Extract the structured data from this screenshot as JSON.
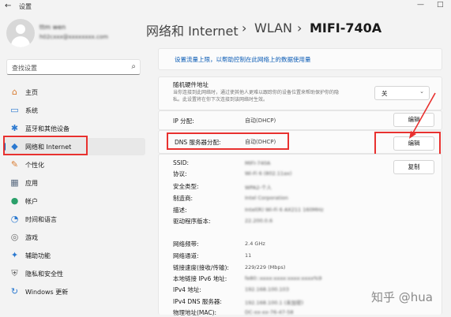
{
  "window": {
    "title": "设置",
    "back_icon": "←",
    "minimize": "—",
    "maximize": "□"
  },
  "user": {
    "name": "ttm wen",
    "email": "h02cxxx@xxxxxxxx.com"
  },
  "search": {
    "placeholder": "查找设置",
    "icon": "⌕"
  },
  "sidebar": {
    "items": [
      {
        "label": "主页",
        "icon": "⌂",
        "color": "#d97b30"
      },
      {
        "label": "系统",
        "icon": "▭",
        "color": "#2b79d0"
      },
      {
        "label": "蓝牙和其他设备",
        "icon": "✱",
        "color": "#2b79d0"
      },
      {
        "label": "网络和 Internet",
        "icon": "◆",
        "color": "#2b79d0"
      },
      {
        "label": "个性化",
        "icon": "✎",
        "color": "#d97b30"
      },
      {
        "label": "应用",
        "icon": "▦",
        "color": "#5a6b80"
      },
      {
        "label": "帐户",
        "icon": "●",
        "color": "#2aa06a"
      },
      {
        "label": "时间和语言",
        "icon": "◔",
        "color": "#2b79d0"
      },
      {
        "label": "游戏",
        "icon": "◎",
        "color": "#6a6a6a"
      },
      {
        "label": "辅助功能",
        "icon": "✦",
        "color": "#2b79d0"
      },
      {
        "label": "隐私和安全性",
        "icon": "⛨",
        "color": "#6a6a6a"
      },
      {
        "label": "Windows 更新",
        "icon": "↻",
        "color": "#2b79d0"
      }
    ]
  },
  "breadcrumb": {
    "part1": "网络和 Internet",
    "sep1": "›",
    "part2": "WLAN",
    "sep2": "›",
    "part3": "MIFI-740A"
  },
  "content": {
    "limit_link": "设置流量上限，以帮助控制在此网络上的数据使用量",
    "random_mac": {
      "title": "随机硬件地址",
      "desc": "当你连接到此网络时，通过使其他人更难以跟踪你的设备位置来帮助保护你的隐\n私。此设置将在你下次连接到该网络时生效。",
      "value": "关"
    },
    "ip_assign": {
      "label": "IP 分配:",
      "value": "自动(DHCP)",
      "button": "编辑"
    },
    "dns_assign": {
      "label": "DNS 服务器分配:",
      "value": "自动(DHCP)",
      "button": "编辑"
    },
    "copy_button": "复制",
    "props": [
      {
        "label": "SSID:",
        "value": "MIFI-740A",
        "blur": true
      },
      {
        "label": "协议:",
        "value": "Wi-Fi 6 (802.11ax)",
        "blur": true
      },
      {
        "label": "安全类型:",
        "value": "WPA2-个人",
        "blur": true
      },
      {
        "label": "制造商:",
        "value": "Intel Corporation",
        "blur": true
      },
      {
        "label": "描述:",
        "value": "Intel(R) Wi-Fi 6 AX211 160MHz",
        "blur": true
      },
      {
        "label": "驱动程序版本:",
        "value": "22.200.0.6",
        "blur": true
      },
      {
        "label": "网络频带:",
        "value": "2.4 GHz",
        "blur": false
      },
      {
        "label": "网络通道:",
        "value": "11",
        "blur": false
      },
      {
        "label": "链接速度(接收/传输):",
        "value": "229/229 (Mbps)",
        "blur": false
      },
      {
        "label": "本地链接 IPv6 地址:",
        "value": "fe80::xxxx:xxxx:xxxx:xxxx%9",
        "blur": true
      },
      {
        "label": "IPv4 地址:",
        "value": "192.168.100.103",
        "blur": true
      },
      {
        "label": "IPv4 DNS 服务器:",
        "value": "192.168.100.1 (未加密)",
        "blur": true
      },
      {
        "label": "物理地址(MAC):",
        "value": "DC-xx-xx-76-47-58",
        "blur": true
      }
    ]
  },
  "watermark": "知乎 @hua",
  "colors": {
    "accent": "#0067c0",
    "highlight": "#e8312f",
    "link": "#0a5bb5"
  }
}
